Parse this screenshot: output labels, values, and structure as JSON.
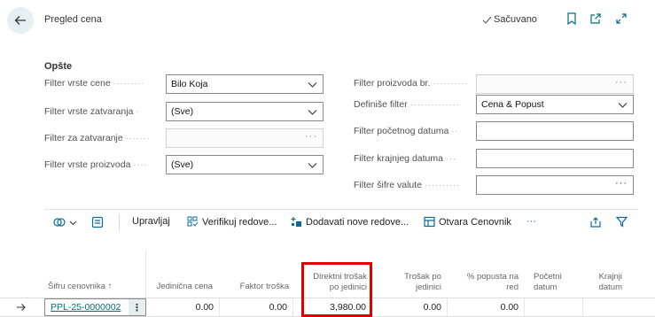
{
  "header": {
    "title": "Pregled cena",
    "saved_label": "Sačuvano"
  },
  "section": {
    "title": "Opšte"
  },
  "left_fields": [
    {
      "label": "Filter vrste cene",
      "value": "Bilo Koja",
      "kind": "select"
    },
    {
      "label": "Filter vrste zatvaranja",
      "value": "(Sve)",
      "kind": "select"
    },
    {
      "label": "Filter za zatvaranje",
      "value": "",
      "kind": "lookup-disabled"
    },
    {
      "label": "Filter vrste proizvoda",
      "value": "(Sve)",
      "kind": "select"
    }
  ],
  "right_fields": [
    {
      "label": "Filter proizvoda br.",
      "value": "",
      "kind": "lookup-disabled"
    },
    {
      "label": "Definiše filter",
      "value": "Cena & Popust",
      "kind": "select"
    },
    {
      "label": "Filter početnog datuma",
      "value": "",
      "kind": "text"
    },
    {
      "label": "Filter krajnjeg datuma",
      "value": "",
      "kind": "text"
    },
    {
      "label": "Filter šifre valute",
      "value": "",
      "kind": "lookup"
    }
  ],
  "toolbar": {
    "manage": "Upravljaj",
    "verify": "Verifikuj redove...",
    "add_lines": "Dodavati nove redove...",
    "open_pricelist": "Otvara Cenovnik",
    "more": "···"
  },
  "grid": {
    "columns": [
      {
        "line1": "",
        "line2": "Šifru cenovnika ↑"
      },
      {
        "line1": "",
        "line2": "Jedinična cena"
      },
      {
        "line1": "",
        "line2": "Faktor troška"
      },
      {
        "line1": "Direktni trošak",
        "line2": "po jedinici"
      },
      {
        "line1": "Trošak po",
        "line2": "jedinici"
      },
      {
        "line1": "% popusta na",
        "line2": "red"
      },
      {
        "line1": "Početni",
        "line2": "datum"
      },
      {
        "line1": "Krajnji",
        "line2": "datum"
      }
    ],
    "row": {
      "code": "PPL-25-0000002",
      "unit_price": "0.00",
      "cost_factor": "0.00",
      "direct_unit_cost": "3,980.00",
      "unit_cost": "0.00",
      "line_discount": "0.00",
      "start_date": "",
      "end_date": ""
    }
  },
  "colors": {
    "accent": "#00707a",
    "highlight": "#e00000"
  }
}
